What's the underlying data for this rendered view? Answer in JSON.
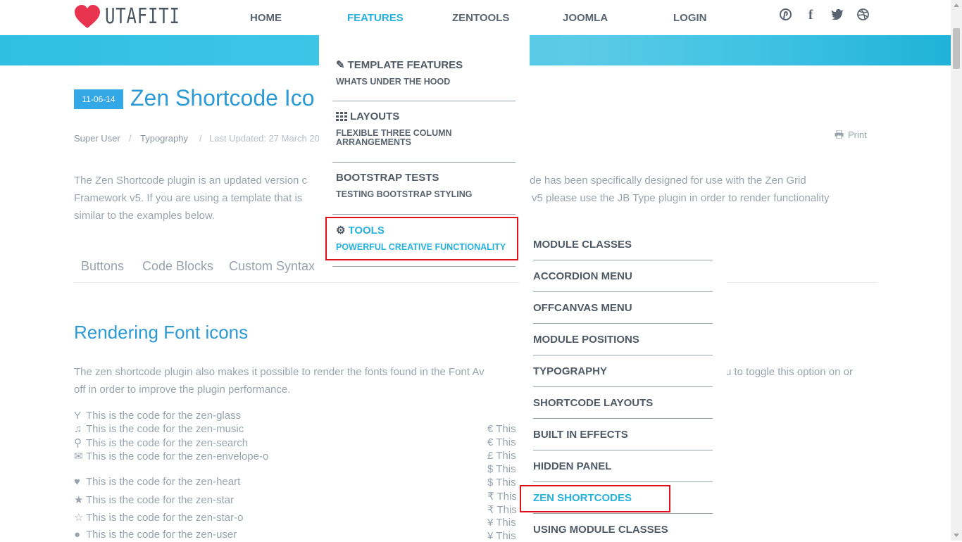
{
  "site": {
    "logo_text": "UTAFITI",
    "logo_icon": "heart-icon"
  },
  "nav": [
    {
      "label": "HOME"
    },
    {
      "label": "FEATURES"
    },
    {
      "label": "ZENTOOLS"
    },
    {
      "label": "JOOMLA"
    },
    {
      "label": "LOGIN"
    }
  ],
  "social_icons": [
    "pinterest-icon",
    "facebook-icon",
    "twitter-icon",
    "dribbble-icon"
  ],
  "article": {
    "date": "11-06-14",
    "title": "Zen Shortcode Ico",
    "author": "Super User",
    "category": "Typography",
    "updated": "Last Updated: 27 March 20",
    "print": "Print",
    "intro_line1a": "The Zen Shortcode plugin is an updated version c",
    "intro_line1b": "de has been specifically designed for use with the Zen Grid",
    "intro_line2a": "Framework v5. If you are using a template that is",
    "intro_line2b": "v5 please use the JB Type plugin in order to render functionality",
    "intro_line3": "similar to the examples below."
  },
  "tabs": [
    "Buttons",
    "Code Blocks",
    "Custom Syntax"
  ],
  "section": {
    "title": "Rendering Font icons",
    "para_line1a": "The zen shortcode plugin also makes it possible to render the fonts found in the Font Av",
    "para_line1b": "u to toggle this option on or",
    "para_line2": "off in order to improve the plugin performance."
  },
  "icon_list": [
    {
      "icon": "glass-icon",
      "text": "This is the code for the zen-glass"
    },
    {
      "icon": "music-icon",
      "text": "This is the code for the zen-music"
    },
    {
      "icon": "search-icon",
      "text": "This is the code for the zen-search"
    },
    {
      "icon": "envelope-icon",
      "text": "This is the code for the zen-envelope-o"
    },
    {
      "icon": "heart-icon",
      "text": "This is the code for the zen-heart"
    },
    {
      "icon": "star-icon",
      "text": "This is the code for the zen-star"
    },
    {
      "icon": "star-o-icon",
      "text": "This is the code for the zen-star-o"
    },
    {
      "icon": "user-icon",
      "text": "This is the code for the zen-user"
    }
  ],
  "currency_list": [
    {
      "symbol": "€",
      "text": "This"
    },
    {
      "symbol": "€",
      "text": "This"
    },
    {
      "symbol": "£",
      "text": "This"
    },
    {
      "symbol": "$",
      "text": "This"
    },
    {
      "symbol": "$",
      "text": "This"
    },
    {
      "symbol": "₹",
      "text": "This"
    },
    {
      "symbol": "₹",
      "text": "This"
    },
    {
      "symbol": "¥",
      "text": "This"
    },
    {
      "symbol": "¥",
      "text": "This"
    }
  ],
  "features_menu": [
    {
      "icon": "pencil-icon",
      "title": "TEMPLATE FEATURES",
      "subtitle": "WHATS UNDER THE HOOD"
    },
    {
      "icon": "th-icon",
      "title": "LAYOUTS",
      "subtitle": "FLEXIBLE THREE COLUMN ARRANGEMENTS"
    },
    {
      "icon": "",
      "title": "BOOTSTRAP TESTS",
      "subtitle": "TESTING BOOTSTRAP STYLING"
    },
    {
      "icon": "cogs-icon",
      "title": "TOOLS",
      "subtitle": "POWERFUL CREATIVE FUNCTIONALITY",
      "active": true
    }
  ],
  "tools_submenu": [
    {
      "label": "MODULE CLASSES"
    },
    {
      "label": "ACCORDION MENU"
    },
    {
      "label": "OFFCANVAS MENU"
    },
    {
      "label": "MODULE POSITIONS"
    },
    {
      "label": "TYPOGRAPHY"
    },
    {
      "label": "SHORTCODE LAYOUTS"
    },
    {
      "label": "BUILT IN EFFECTS"
    },
    {
      "label": "HIDDEN PANEL"
    },
    {
      "label": "ZEN SHORTCODES",
      "active": true
    },
    {
      "label": "USING MODULE CLASSES"
    }
  ],
  "colors": {
    "accent": "#26b1dc",
    "title_blue": "#2c9ad6",
    "badge": "#33a8e6",
    "highlight": "#e0101a"
  }
}
